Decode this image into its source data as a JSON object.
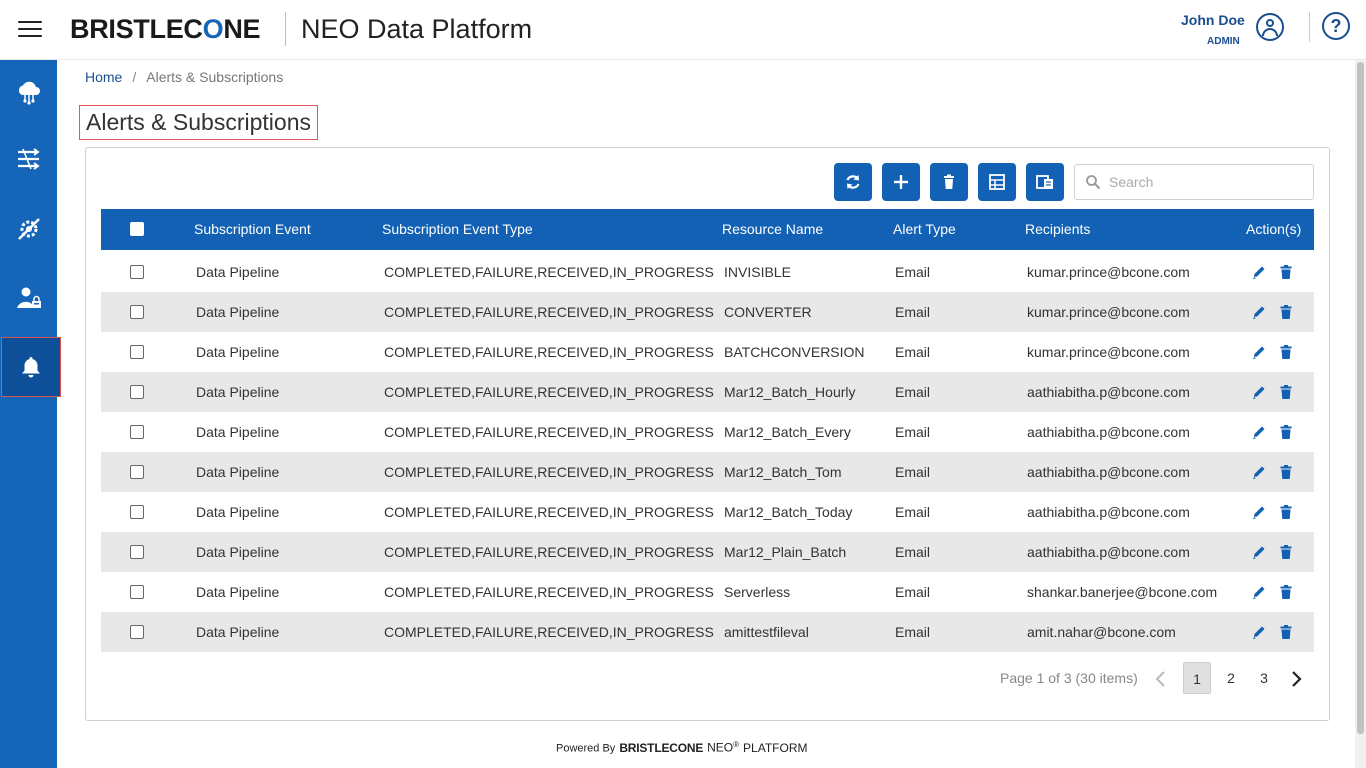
{
  "header": {
    "logo_pre": "BRISTLEC",
    "logo_o": "O",
    "logo_post": "NE",
    "app_title": "NEO Data Platform",
    "user_name": "John Doe",
    "user_role": "ADMIN",
    "help_label": "?"
  },
  "sidebar": {
    "items": [
      {
        "icon": "cloud-network-icon"
      },
      {
        "icon": "data-flow-icon"
      },
      {
        "icon": "settings-tools-icon"
      },
      {
        "icon": "user-lock-icon"
      },
      {
        "icon": "bell-icon",
        "active": true
      }
    ]
  },
  "breadcrumb": {
    "home": "Home",
    "separator": "/",
    "current": "Alerts & Subscriptions"
  },
  "page_title": "Alerts & Subscriptions",
  "toolbar": {
    "buttons": [
      "refresh-icon",
      "add-icon",
      "delete-icon",
      "export-excel-icon",
      "export-copy-icon"
    ],
    "search_placeholder": "Search",
    "search_value": ""
  },
  "table": {
    "columns": [
      "Subscription Event",
      "Subscription Event Type",
      "Resource Name",
      "Alert Type",
      "Recipients",
      "Action(s)"
    ],
    "rows": [
      {
        "event": "Data Pipeline",
        "type": "COMPLETED,FAILURE,RECEIVED,IN_PROGRESS",
        "resource": "INVISIBLE",
        "alert": "Email",
        "recipients": "kumar.prince@bcone.com"
      },
      {
        "event": "Data Pipeline",
        "type": "COMPLETED,FAILURE,RECEIVED,IN_PROGRESS",
        "resource": "CONVERTER",
        "alert": "Email",
        "recipients": "kumar.prince@bcone.com"
      },
      {
        "event": "Data Pipeline",
        "type": "COMPLETED,FAILURE,RECEIVED,IN_PROGRESS",
        "resource": "BATCHCONVERSION",
        "alert": "Email",
        "recipients": "kumar.prince@bcone.com"
      },
      {
        "event": "Data Pipeline",
        "type": "COMPLETED,FAILURE,RECEIVED,IN_PROGRESS",
        "resource": "Mar12_Batch_Hourly",
        "alert": "Email",
        "recipients": "aathiabitha.p@bcone.com"
      },
      {
        "event": "Data Pipeline",
        "type": "COMPLETED,FAILURE,RECEIVED,IN_PROGRESS",
        "resource": "Mar12_Batch_Every",
        "alert": "Email",
        "recipients": "aathiabitha.p@bcone.com"
      },
      {
        "event": "Data Pipeline",
        "type": "COMPLETED,FAILURE,RECEIVED,IN_PROGRESS",
        "resource": "Mar12_Batch_Tom",
        "alert": "Email",
        "recipients": "aathiabitha.p@bcone.com"
      },
      {
        "event": "Data Pipeline",
        "type": "COMPLETED,FAILURE,RECEIVED,IN_PROGRESS",
        "resource": "Mar12_Batch_Today",
        "alert": "Email",
        "recipients": "aathiabitha.p@bcone.com"
      },
      {
        "event": "Data Pipeline",
        "type": "COMPLETED,FAILURE,RECEIVED,IN_PROGRESS",
        "resource": "Mar12_Plain_Batch",
        "alert": "Email",
        "recipients": "aathiabitha.p@bcone.com"
      },
      {
        "event": "Data Pipeline",
        "type": "COMPLETED,FAILURE,RECEIVED,IN_PROGRESS",
        "resource": "Serverless",
        "alert": "Email",
        "recipients": "shankar.banerjee@bcone.com"
      },
      {
        "event": "Data Pipeline",
        "type": "COMPLETED,FAILURE,RECEIVED,IN_PROGRESS",
        "resource": "amittestfileval",
        "alert": "Email",
        "recipients": "amit.nahar@bcone.com"
      }
    ]
  },
  "pagination": {
    "info": "Page 1 of 3 (30 items)",
    "pages": [
      "1",
      "2",
      "3"
    ],
    "current": "1"
  },
  "footer": {
    "powered_by": "Powered By",
    "brand": "BRISTLECONE",
    "neo": "NEO",
    "reg": "®",
    "platform": "PLATFORM"
  },
  "colors": {
    "primary": "#1261b4",
    "sidebar": "#1565b8",
    "sidebar_active": "#0e4f99",
    "highlight_border": "#e05a5a",
    "row_alt": "#e8e8e8"
  }
}
